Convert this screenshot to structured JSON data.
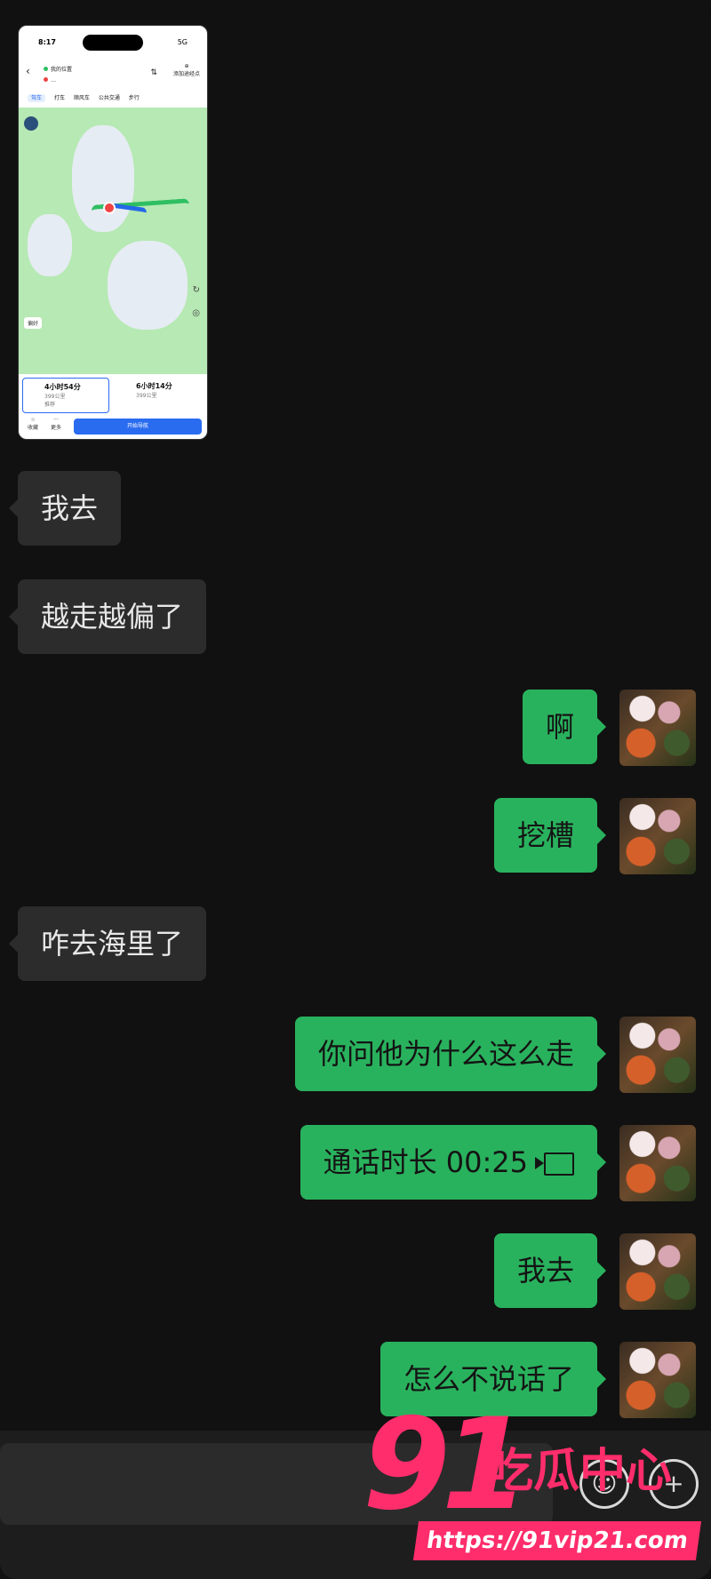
{
  "shared_screenshot": {
    "status": {
      "time": "8:17",
      "network": "5G"
    },
    "route": {
      "from": "我的位置",
      "to": "…",
      "add_label": "添加途经点",
      "modes": [
        "驾车",
        "打车",
        "顺风车",
        "公共交通",
        "步行"
      ]
    },
    "map": {
      "preference_label": "偏好"
    },
    "plans": [
      {
        "duration": "4小时54分",
        "distance": "399公里",
        "tag": "推荐"
      },
      {
        "duration": "6小时14分",
        "distance": "399公里",
        "tag": ""
      }
    ],
    "bottom": {
      "fav_label": "收藏",
      "more_label": "更多",
      "start_label": "开始导航"
    }
  },
  "messages": [
    {
      "side": "in",
      "text": "我去"
    },
    {
      "side": "in",
      "text": "越走越偏了"
    },
    {
      "side": "out",
      "text": "啊"
    },
    {
      "side": "out",
      "text": "挖槽"
    },
    {
      "side": "in",
      "text": "咋去海里了"
    },
    {
      "side": "out",
      "text": "你问他为什么这么走"
    },
    {
      "side": "out",
      "text": "通话时长 00:25",
      "icon": "video-call-icon"
    },
    {
      "side": "out",
      "text": "我去"
    },
    {
      "side": "out",
      "text": "怎么不说话了"
    }
  ],
  "input_bar": {
    "emoji_icon": "emoji-icon",
    "plus_icon": "plus-icon"
  },
  "watermark": {
    "number": "91",
    "text": "吃瓜中心",
    "url": "https://91vip21.com"
  },
  "colors": {
    "incoming_bubble": "#2c2c2c",
    "outgoing_bubble": "#29b25d",
    "background": "#111111",
    "watermark": "#ff2d6b"
  }
}
